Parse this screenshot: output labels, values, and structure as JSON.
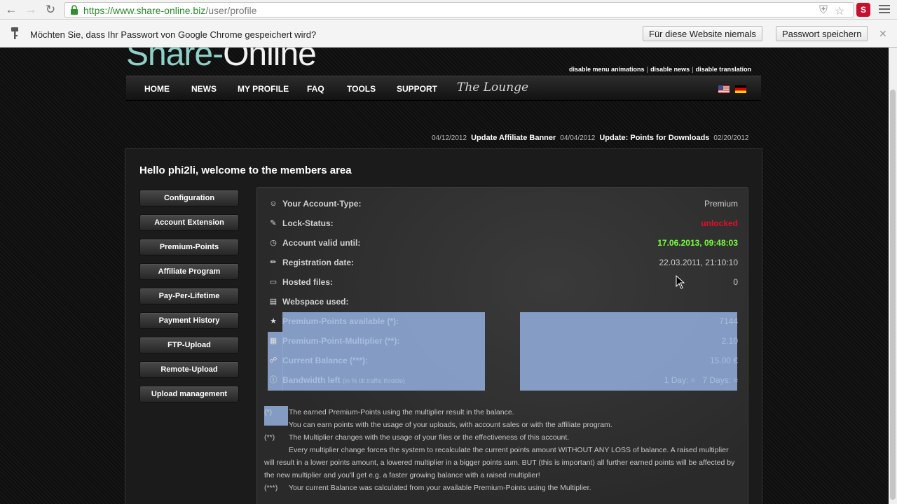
{
  "browser": {
    "url_prefix": "https://www.share-online.biz",
    "url_path": "/user/profile",
    "ext_label": "S"
  },
  "infobar": {
    "message": "Möchten Sie, dass Ihr Passwort von Google Chrome gespeichert wird?",
    "never_button": "Für diese Website niemals",
    "save_button": "Passwort speichern"
  },
  "site": {
    "logo_prefix": "Share-",
    "logo_suffix": "Online",
    "top_links": [
      "disable menu animations",
      "disable news",
      "disable translation"
    ],
    "nav": [
      "HOME",
      "NEWS",
      "MY PROFILE",
      "FAQ",
      "TOOLS",
      "SUPPORT"
    ],
    "lounge": "The Lounge"
  },
  "news": {
    "date1": "04/12/2012",
    "headline1": "Update Affiliate Banner",
    "date2": "04/04/2012",
    "headline2": "Update: Points for Downloads",
    "date3": "02/20/2012"
  },
  "members": {
    "welcome": "Hello phi2li, welcome to the members area",
    "menu": [
      "Configuration",
      "Account Extension",
      "Premium-Points",
      "Affiliate Program",
      "Pay-Per-Lifetime",
      "Payment History",
      "FTP-Upload",
      "Remote-Upload",
      "Upload management"
    ]
  },
  "account": {
    "type_label": "Your Account-Type:",
    "type_value": "Premium",
    "lock_label": "Lock-Status:",
    "lock_value": "unlocked",
    "valid_label": "Account valid until:",
    "valid_value": "17.06.2013, 09:48:03",
    "reg_label": "Registration date:",
    "reg_value": "22.03.2011, 21:10:10",
    "files_label": "Hosted files:",
    "files_value": "0",
    "webspace_label": "Webspace used:",
    "points_label": "Premium-Points available (*):",
    "points_value": "7144",
    "multiplier_label": "Premium-Point-Multiplier (**):",
    "multiplier_value": "2.10",
    "balance_label": "Current Balance (***):",
    "balance_value": "15.00 €",
    "bandwidth_label": "Bandwidth left",
    "bandwidth_note": "(in % till traffic throttle)",
    "bandwidth_day": "1 Day:",
    "bandwidth_week": "7 Days:"
  },
  "footnotes": {
    "mark1": "(*)",
    "line1": "The earned Premium-Points using the multiplier result in the balance.",
    "line2": "You can earn points with the usage of your uploads, with account sales or with the affiliate program.",
    "mark2": "(**)",
    "line3": "The Multiplier changes with the usage of your files or the effectiveness of this account.",
    "line4": "Every multiplier change forces the system to recalculate the current points amount WITHOUT ANY LOSS of balance. A raised multiplier will result in a lower points amount, a lowered multiplier in a bigger points sum. BUT (this is important) all further earned points will be affected by the new multiplier and you'll get e.g. a faster growing balance with a raised multiplier!",
    "mark3": "(***)",
    "line5": "Your current Balance was calculated from your available Premium-Points using the Multiplier."
  }
}
